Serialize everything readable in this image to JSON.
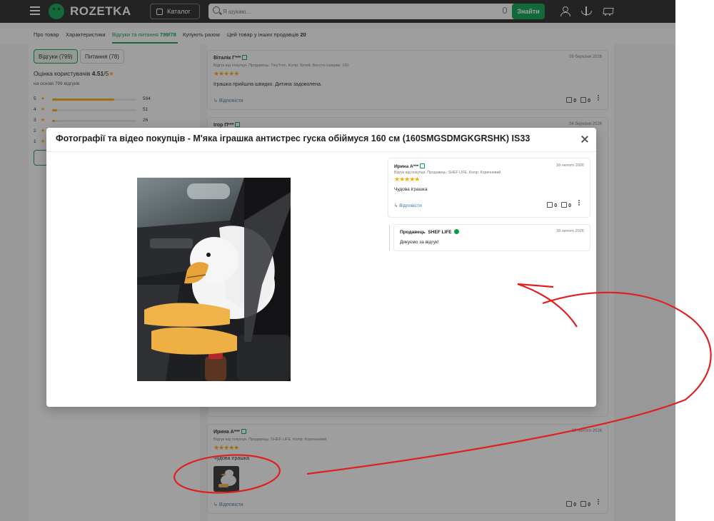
{
  "header": {
    "logo_text": "ROZETKA",
    "catalog_label": "Каталог",
    "search_placeholder": "Я шукаю...",
    "search_button": "Знайти"
  },
  "tabs": [
    {
      "label": "Про товар"
    },
    {
      "label": "Характеристики"
    },
    {
      "label": "Відгуки та питання",
      "count": "799/78"
    },
    {
      "label": "Купують разом"
    },
    {
      "label": "Цей товар у інших продавців",
      "count": "20"
    }
  ],
  "left_panel": {
    "reviews_pill": "Відгуки (799)",
    "questions_pill": "Питання (78)",
    "rating_label": "Оцінка користувачів",
    "rating_value": "4.51",
    "rating_max": "/5",
    "based_on": "на основі",
    "based_on_count": "799 відгуків",
    "bars": [
      {
        "stars": "5",
        "count": "594",
        "fraction": 0.74
      },
      {
        "stars": "4",
        "count": "51",
        "fraction": 0.06
      },
      {
        "stars": "3",
        "count": "26",
        "fraction": 0.03
      },
      {
        "stars": "2",
        "count": "",
        "fraction": 0.02
      },
      {
        "stars": "1",
        "count": "",
        "fraction": 0.05
      }
    ]
  },
  "reviews": [
    {
      "name": "Віталік Г***",
      "date": "09 березня 2026",
      "meta": "Відгук від покупця. Продавець: TinyTron. Колір: Білий. Висота іграшки: 150",
      "text": "Іграшка прийшла швидко. Дитина задоволена.",
      "reply": "Відповісти",
      "likes": "0",
      "dislikes": "0"
    },
    {
      "name": "Ігор П***",
      "date": "04 березня 2026"
    },
    {
      "name": "Ирина А***",
      "date": "18 лютого 2026",
      "meta": "Відгук від покупця. Продавець: SHEF LIFE. Колір: Коричневий",
      "text": "Чудова іграшка",
      "reply": "Відповісти",
      "likes": "0",
      "dislikes": "0"
    }
  ],
  "modal": {
    "title": "Фотографії та відео покупців - М'яка іграшка антистрес гуска обіймуся 160 см (160SMGSDMGKGRSHK) IS33",
    "review": {
      "name": "Ирина А***",
      "date": "18 лютого 2026",
      "meta": "Відгук від покупця. Продавець: SHEF LIFE. Колір: Коричневий",
      "stars": "★★★★★",
      "text": "Чудова іграшка",
      "reply": "Відповісти",
      "likes": "0",
      "dislikes": "0"
    },
    "seller_reply": {
      "label": "Продавець",
      "seller": "SHEF LIFE",
      "date": "18 лютого 2026",
      "text": "Дякуємо за відгук!"
    }
  },
  "colors": {
    "brand_green": "#00a046",
    "header_bg": "#221f1f",
    "star": "#ffa900",
    "annotation": "#e02020"
  }
}
